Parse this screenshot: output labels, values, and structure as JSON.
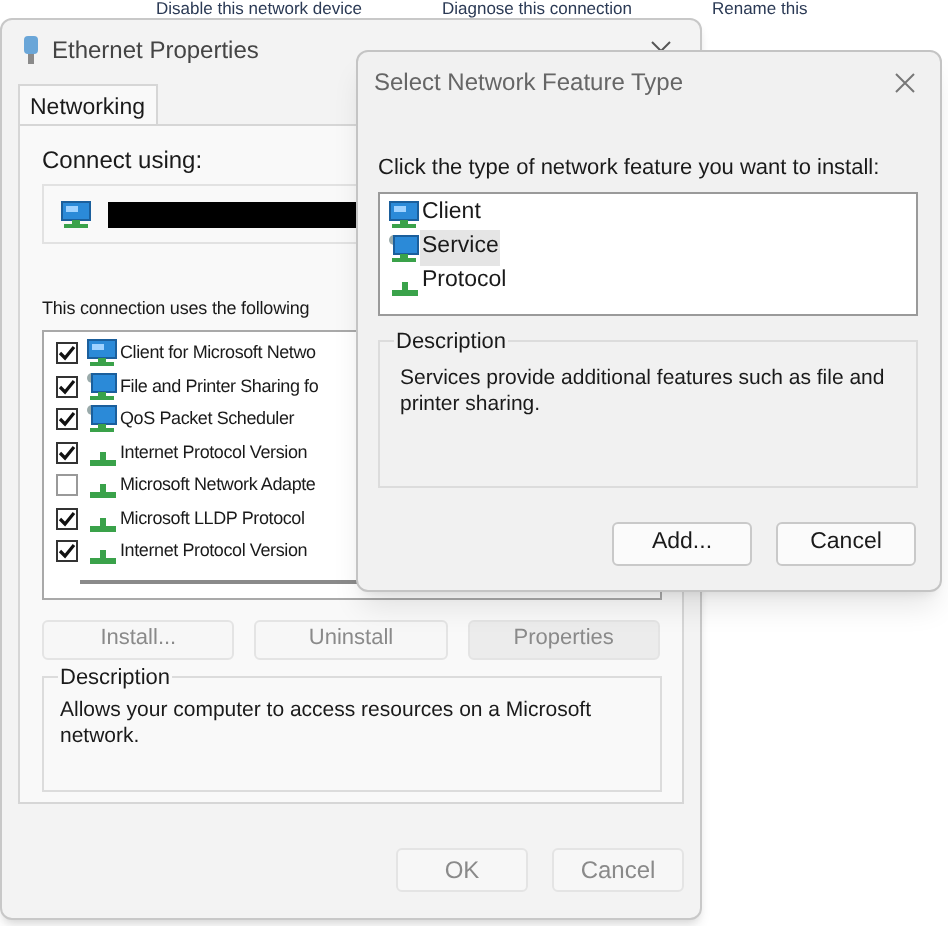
{
  "explorer_bar": {
    "items": [
      "Disable this network device",
      "Diagnose this connection",
      "Rename this"
    ]
  },
  "properties": {
    "title": "Ethernet Properties",
    "tabs": [
      {
        "label": "Networking",
        "selected": true
      }
    ],
    "connect_label": "Connect using:",
    "components_label": "This connection uses the following",
    "components": [
      {
        "label": "Client for Microsoft Netwo",
        "checked": true,
        "kind": "client"
      },
      {
        "label": "File and Printer Sharing fo",
        "checked": true,
        "kind": "service"
      },
      {
        "label": "QoS Packet Scheduler",
        "checked": true,
        "kind": "service"
      },
      {
        "label": "Internet Protocol Version",
        "checked": true,
        "kind": "protocol"
      },
      {
        "label": "Microsoft Network Adapte",
        "checked": false,
        "kind": "protocol"
      },
      {
        "label": "Microsoft LLDP Protocol",
        "checked": true,
        "kind": "protocol"
      },
      {
        "label": "Internet Protocol Version",
        "checked": true,
        "kind": "protocol"
      }
    ],
    "buttons": [
      "Install...",
      "Uninstall",
      "Properties"
    ],
    "description_label": "Description",
    "description": "Allows your computer to access resources on a Microsoft network.",
    "footer_buttons": [
      "OK",
      "Cancel"
    ]
  },
  "dialog": {
    "title": "Select Network Feature Type",
    "prompt": "Click the type of network feature you want to install:",
    "types": [
      {
        "label": "Client",
        "kind": "client",
        "selected": false
      },
      {
        "label": "Service",
        "kind": "service",
        "selected": true
      },
      {
        "label": "Protocol",
        "kind": "protocol",
        "selected": false
      }
    ],
    "description_label": "Description",
    "description": "Services provide additional features such as file and printer sharing.",
    "buttons": [
      "Add...",
      "Cancel"
    ]
  }
}
